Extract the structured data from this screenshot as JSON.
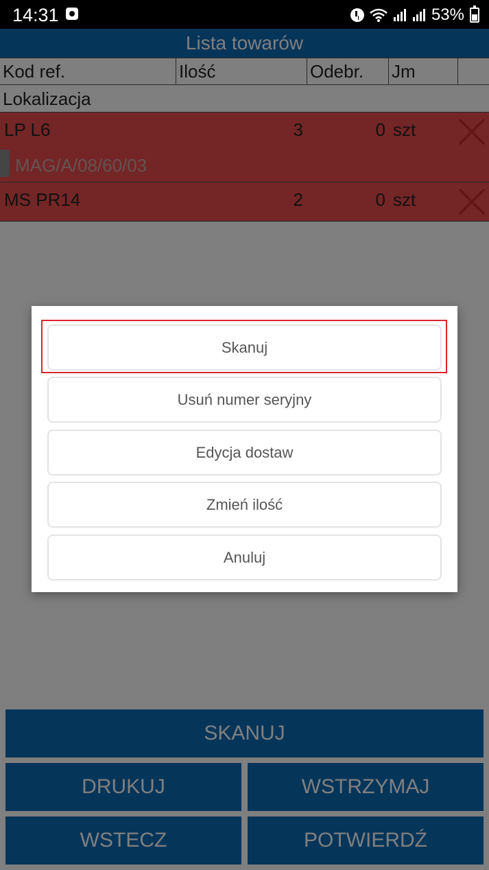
{
  "status_bar": {
    "time": "14:31",
    "battery": "53%"
  },
  "header": {
    "title": "Lista towarów"
  },
  "table": {
    "columns": [
      "Kod ref.",
      "Ilość",
      "Odebr.",
      "Jm",
      ""
    ],
    "subheader": "Lokalizacja",
    "rows": [
      {
        "code": "LP L6",
        "qty": "3",
        "received": "0",
        "unit": "szt",
        "location": "MAG/A/08/60/03"
      },
      {
        "code": "MS PR14",
        "qty": "2",
        "received": "0",
        "unit": "szt"
      }
    ],
    "row_color": "#e94b4b"
  },
  "bottom_buttons": {
    "scan": "SKANUJ",
    "print": "DRUKUJ",
    "hold": "WSTRZYMAJ",
    "back": "WSTECZ",
    "confirm": "POTWIERDŹ"
  },
  "dialog": {
    "options": [
      "Skanuj",
      "Usuń numer seryjny",
      "Edycja dostaw",
      "Zmień ilość",
      "Anuluj"
    ],
    "highlighted_index": 0
  },
  "colors": {
    "accent": "#0c6ab4",
    "delete_icon": "#c62828",
    "highlight": "#d9262c"
  }
}
